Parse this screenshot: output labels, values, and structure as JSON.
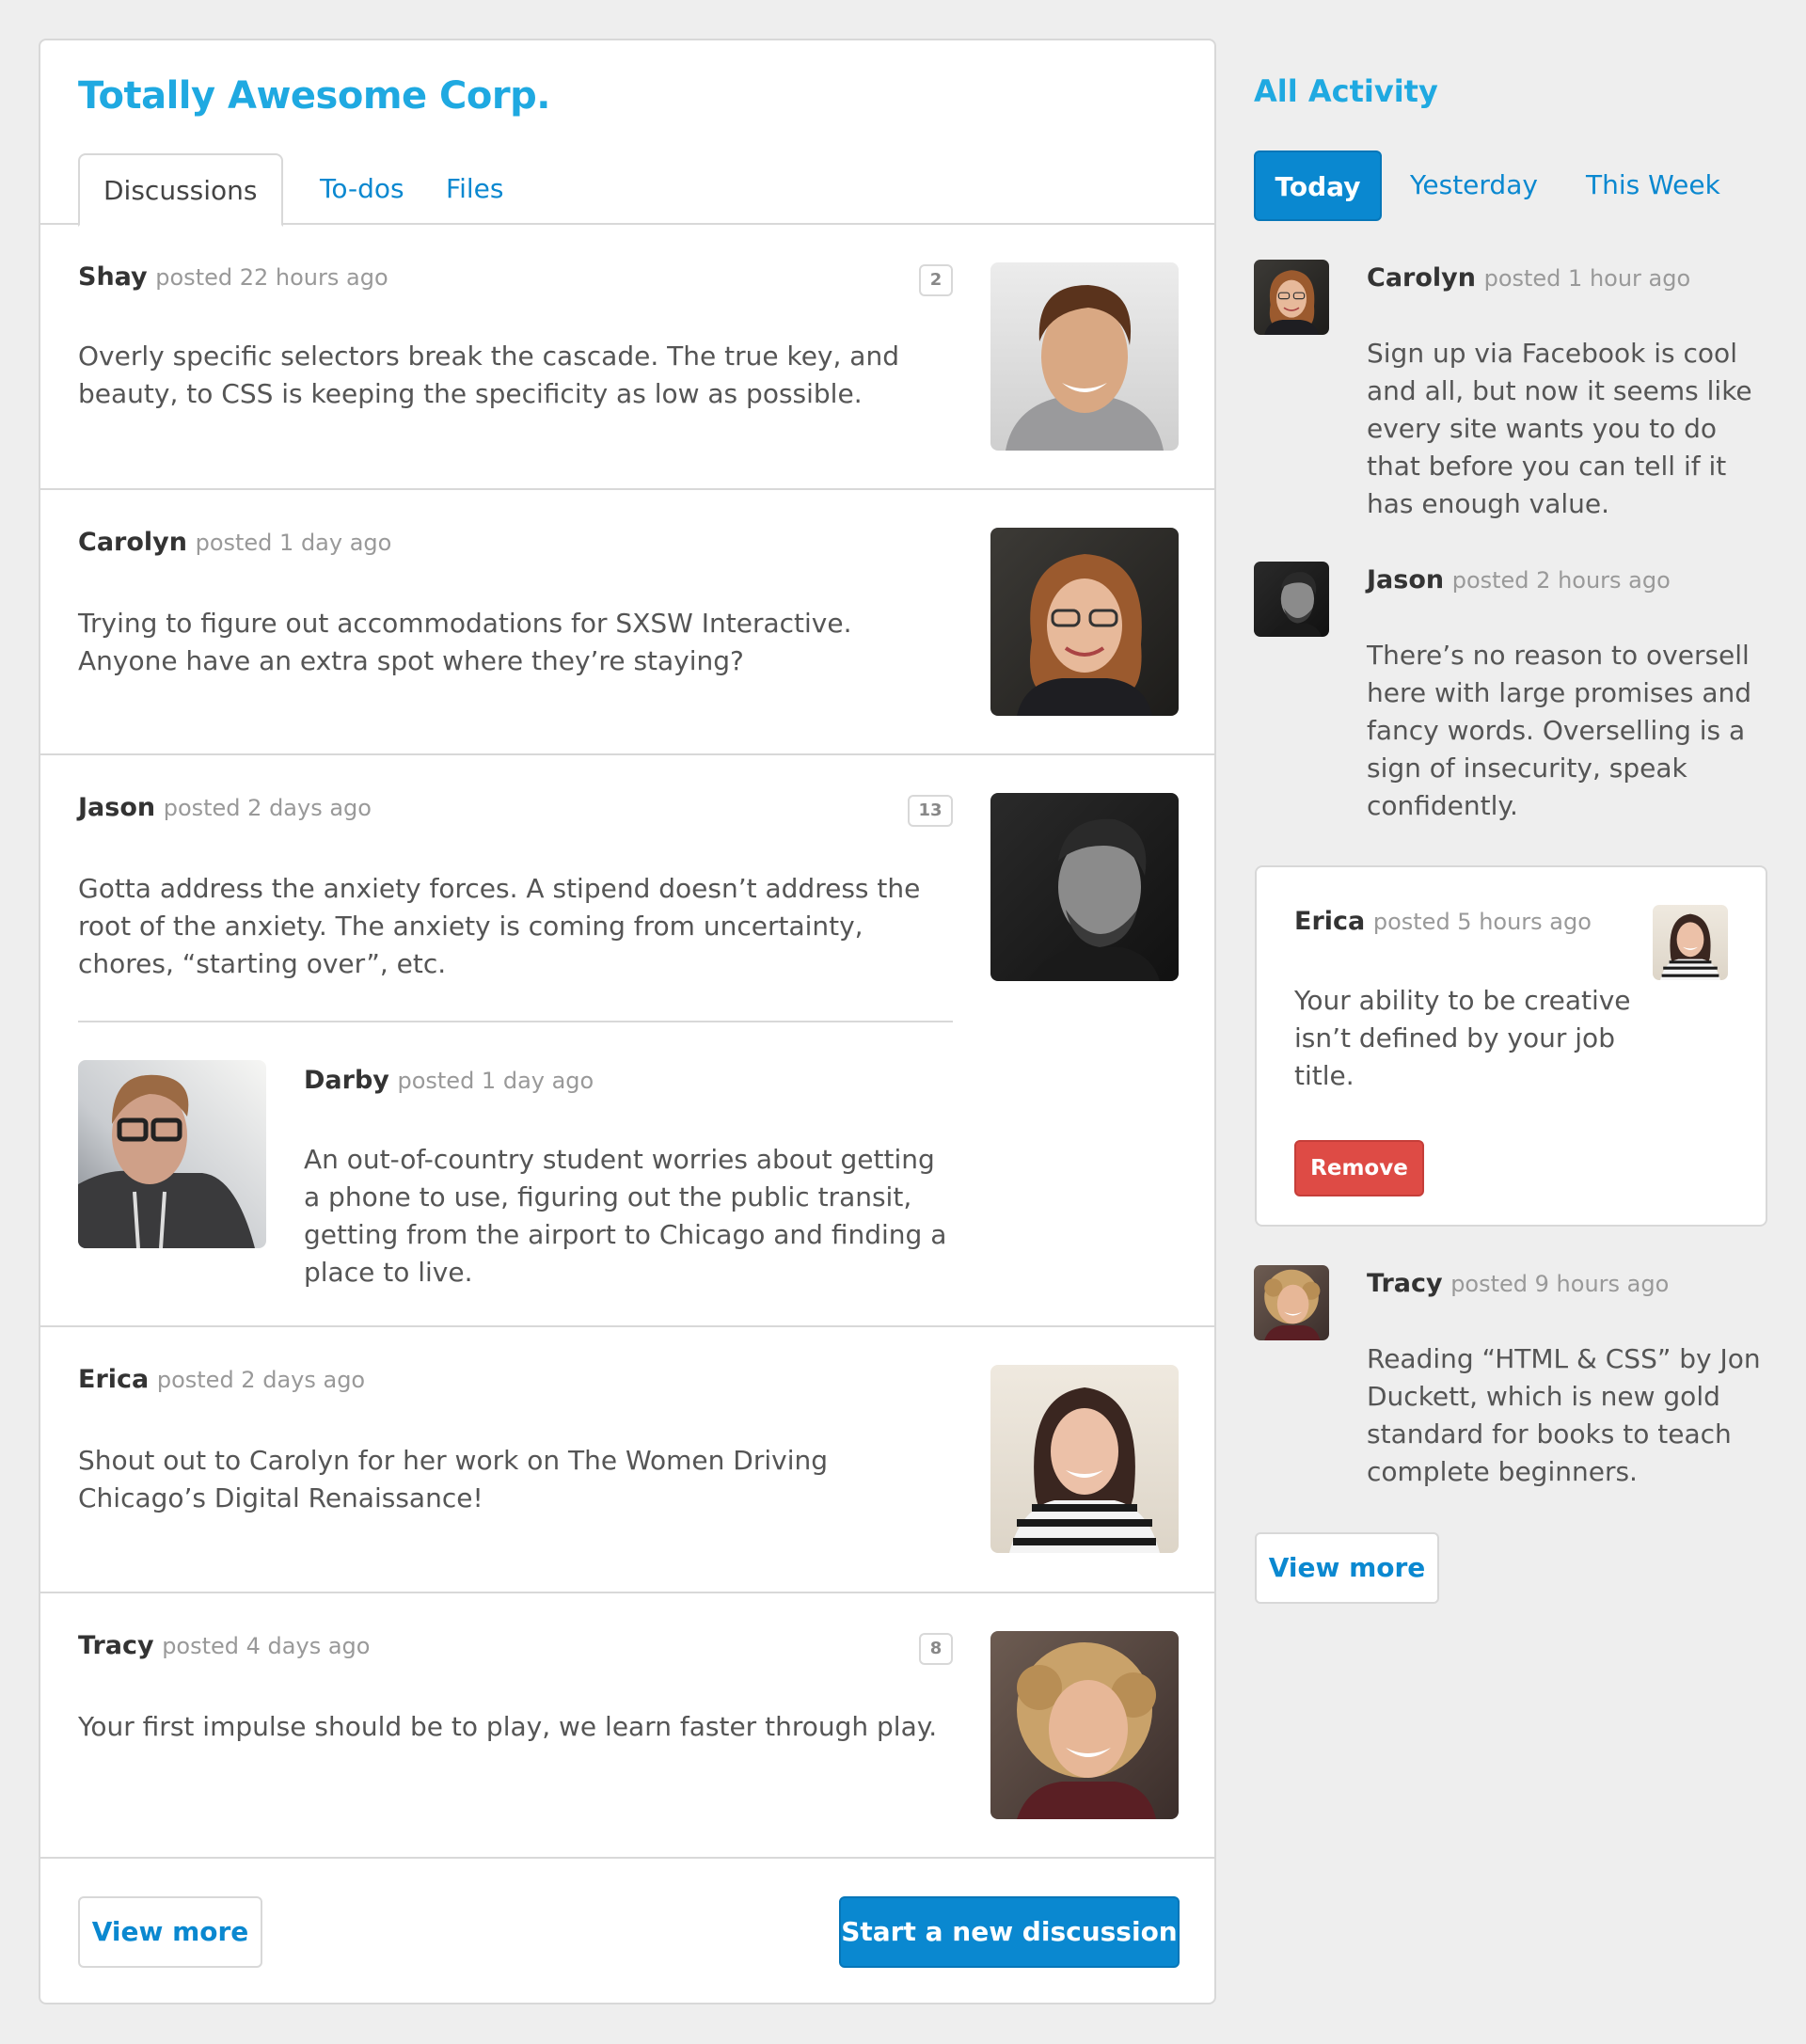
{
  "app": {
    "title": "Totally Awesome Corp."
  },
  "tabs": [
    {
      "label": "Discussions",
      "active": true
    },
    {
      "label": "To-dos",
      "active": false
    },
    {
      "label": "Files",
      "active": false
    }
  ],
  "discussions": [
    {
      "author": "Shay",
      "when": "posted 22 hours ago",
      "body": "Overly specific selectors break the cascade. The true key, and beauty, to CSS is keeping the specificity as low as possible.",
      "count": "2",
      "avatar": "shay"
    },
    {
      "author": "Carolyn",
      "when": "posted 1 day ago",
      "body": "Trying to figure out accommodations for SXSW Interactive. Anyone have an extra spot where they’re staying?",
      "avatar": "carolyn"
    },
    {
      "author": "Jason",
      "when": "posted 2 days ago",
      "body": "Gotta address the anxiety forces. A stipend doesn’t address the root of the anxiety. The anxiety is coming from uncertainty, chores, “starting over”, etc.",
      "count": "13",
      "avatar": "jason",
      "reply": {
        "author": "Darby",
        "when": "posted 1 day ago",
        "body": "An out-of-country student worries about getting a phone to use, figuring out the public transit, getting from the airport to Chicago and finding a place to live.",
        "avatar": "darby"
      }
    },
    {
      "author": "Erica",
      "when": "posted 2 days ago",
      "body": "Shout out to Carolyn for her work on The Women Driving Chicago’s Digital Renaissance!",
      "avatar": "erica"
    },
    {
      "author": "Tracy",
      "when": "posted 4 days ago",
      "body": "Your first impulse should be to play, we learn faster through play.",
      "count": "8",
      "avatar": "tracy"
    }
  ],
  "footer": {
    "view_more": "View more",
    "start_discussion": "Start a new discussion"
  },
  "activity": {
    "title": "All Activity",
    "filters": [
      {
        "label": "Today",
        "active": true
      },
      {
        "label": "Yesterday",
        "active": false
      },
      {
        "label": "This Week",
        "active": false
      }
    ],
    "items": [
      {
        "author": "Carolyn",
        "when": "posted 1 hour ago",
        "body": "Sign up via Facebook is cool and all, but now it seems like every site wants you to do that before you can tell if it has enough value."
      },
      {
        "author": "Jason",
        "when": "posted 2 hours ago",
        "body": "There’s no reason to oversell here with large promises and fancy words. Overselling is a sign of insecurity, speak confidently."
      },
      {
        "author": "Erica",
        "when": "posted 5 hours ago",
        "body": "Your ability to be creative isn’t defined by your job title.",
        "action": "Remove"
      },
      {
        "author": "Tracy",
        "when": "posted 9 hours ago",
        "body": "Reading “HTML & CSS” by Jon Duckett, which is new gold standard for books to teach complete beginners."
      }
    ],
    "view_more": "View more"
  },
  "colors": {
    "accent": "#1fa9e1",
    "link": "#0a88d0",
    "danger": "#de4b45",
    "background": "#eeeeee"
  }
}
